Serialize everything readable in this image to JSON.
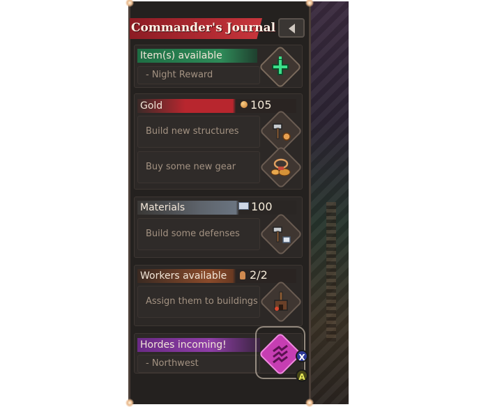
{
  "journal": {
    "title": "Commander's Journal"
  },
  "items": {
    "header": "Item(s) available",
    "entries": [
      "- Night Reward"
    ]
  },
  "gold": {
    "header": "Gold",
    "amount": "105",
    "entries": [
      "Build new structures",
      "Buy some new gear"
    ]
  },
  "materials": {
    "header": "Materials",
    "amount": "100",
    "entries": [
      "Build some defenses"
    ]
  },
  "workers": {
    "header": "Workers available",
    "amount": "2/2",
    "entries": [
      "Assign them to buildings"
    ]
  },
  "hordes": {
    "header": "Hordes incoming!",
    "entries": [
      "- Northwest"
    ]
  },
  "controls": {
    "x_button": "X",
    "a_button": "A"
  },
  "icons": {
    "collapse": "collapse-left-icon",
    "items": "green-puzzle-icon",
    "build": "hammer-coin-icon",
    "gear": "treasure-gear-icon",
    "defense": "hammer-material-icon",
    "workers": "building-worker-icon",
    "hordes": "horde-sigil-icon"
  },
  "colors": {
    "gold_bar": "#b8262e",
    "items_bar": "#2e8a58",
    "materials_bar": "#6a7480",
    "workers_bar": "#8a4a2a",
    "hordes_bar": "#8e3ea6",
    "highlight": "#e24ad0"
  }
}
